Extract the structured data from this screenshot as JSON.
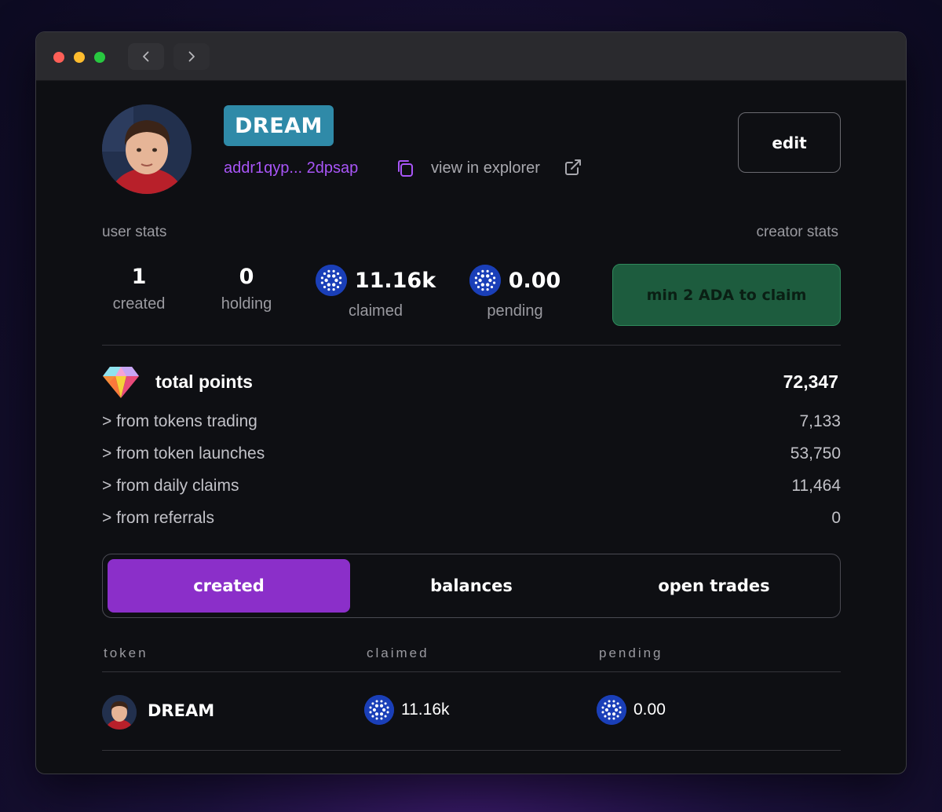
{
  "profile": {
    "name": "DREAM",
    "address": "addr1qyp... 2dpsap",
    "explorer_label": "view in explorer",
    "edit_label": "edit"
  },
  "stats": {
    "user_stats_label": "user stats",
    "creator_stats_label": "creator stats",
    "created": {
      "value": "1",
      "label": "created"
    },
    "holding": {
      "value": "0",
      "label": "holding"
    },
    "claimed": {
      "value": "11.16k",
      "label": "claimed"
    },
    "pending": {
      "value": "0.00",
      "label": "pending"
    },
    "claim_button": "min 2 ADA to claim"
  },
  "points": {
    "title": "total points",
    "total": "72,347",
    "rows": [
      {
        "label": "> from tokens trading",
        "value": "7,133"
      },
      {
        "label": "> from token launches",
        "value": "53,750"
      },
      {
        "label": "> from daily claims",
        "value": "11,464"
      },
      {
        "label": "> from referrals",
        "value": "0"
      }
    ]
  },
  "tabs": [
    {
      "label": "created",
      "active": true
    },
    {
      "label": "balances",
      "active": false
    },
    {
      "label": "open trades",
      "active": false
    }
  ],
  "table": {
    "headers": [
      "token",
      "claimed",
      "pending"
    ],
    "rows": [
      {
        "token": "DREAM",
        "claimed": "11.16k",
        "pending": "0.00"
      }
    ]
  },
  "colors": {
    "accent_purple": "#a855f7",
    "tab_active": "#8b2fc9",
    "name_badge": "#2f8aa8",
    "claim_button": "#1d5c3e",
    "ada_blue": "#1a3fb8"
  },
  "icons": [
    "back-arrow-icon",
    "forward-arrow-icon",
    "copy-icon",
    "external-link-icon",
    "cardano-icon",
    "gem-icon"
  ]
}
